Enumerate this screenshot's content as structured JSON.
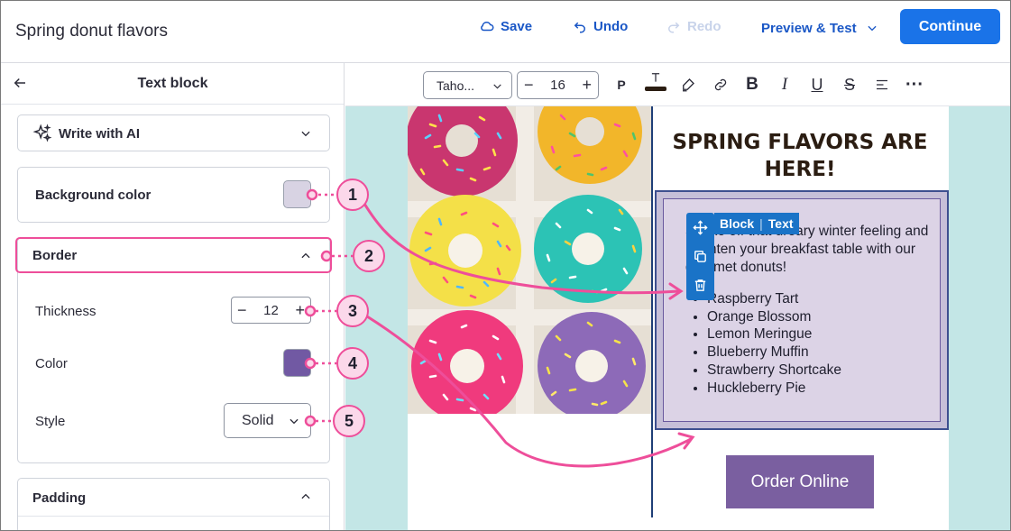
{
  "header": {
    "title": "Spring donut flavors",
    "save": "Save",
    "undo": "Undo",
    "redo": "Redo",
    "preview": "Preview & Test",
    "continue": "Continue"
  },
  "panel": {
    "title": "Text block",
    "ai": "Write with AI",
    "background_label": "Background color",
    "background_color": "#d8d3e3",
    "border_label": "Border",
    "thickness_label": "Thickness",
    "thickness_value": "12",
    "color_label": "Color",
    "border_color": "#7159a3",
    "style_label": "Style",
    "style_value": "Solid",
    "padding_label": "Padding"
  },
  "toolbar": {
    "font": "Taho...",
    "size": "16",
    "paragraph": "P"
  },
  "email": {
    "headline": "SPRING FLAVORS ARE HERE!",
    "body": "Shake off that dreary winter feeling and brighten your breakfast table with our gourmet donuts!",
    "flavors": [
      "Raspberry Tart",
      "Orange Blossom",
      "Lemon Meringue",
      "Blueberry Muffin",
      "Strawberry Shortcake",
      "Huckleberry Pie"
    ],
    "button": "Order Online",
    "block_tag": "Block",
    "block_type": "Text"
  },
  "callouts": [
    "1",
    "2",
    "3",
    "4",
    "5"
  ],
  "colors": {
    "accent": "#1a73e8",
    "annotation": "#ee4e9a"
  }
}
